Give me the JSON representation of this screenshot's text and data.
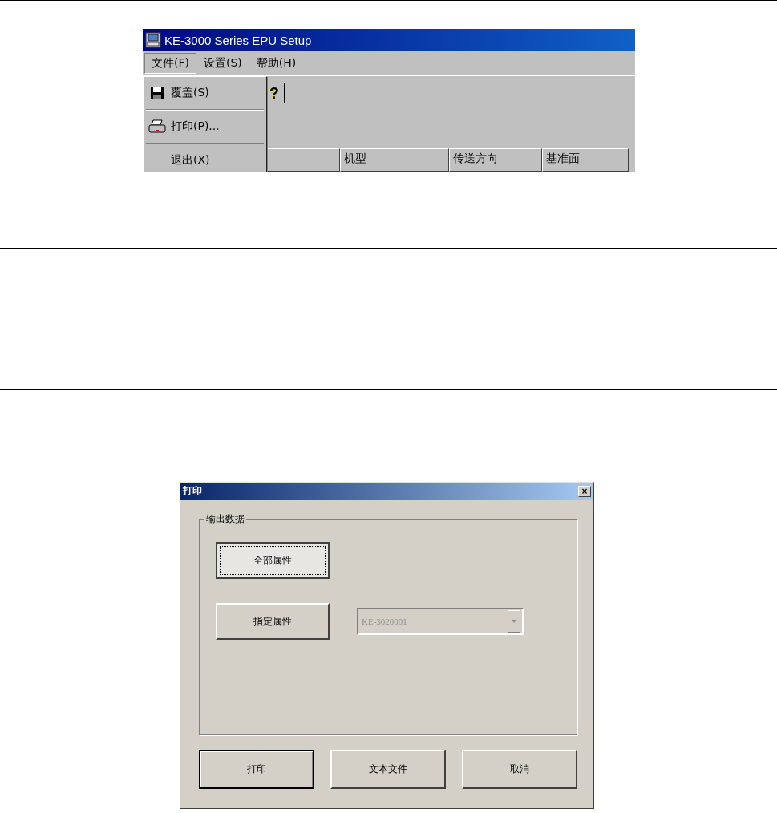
{
  "app_window": {
    "title": "KE-3000 Series EPU Setup",
    "menus": [
      {
        "label": "文件(F)",
        "selected": true
      },
      {
        "label": "设置(S)",
        "selected": false
      },
      {
        "label": "帮助(H)",
        "selected": false
      }
    ],
    "file_menu": {
      "items": [
        {
          "kind": "save",
          "label": "覆盖(S)"
        },
        {
          "kind": "print",
          "label": "打印(P)..."
        },
        {
          "kind": "plain",
          "label": "退出(X)"
        }
      ]
    },
    "toolbar": {
      "help_button": "?"
    },
    "table": {
      "columns": [
        "机型",
        "传送方向",
        "基准面"
      ]
    }
  },
  "print_dialog": {
    "title": "打印",
    "close": "×",
    "group": {
      "label": "输出数据",
      "buttons": [
        {
          "label": "全部属性",
          "focused": true
        },
        {
          "label": "指定属性",
          "focused": false
        }
      ],
      "dropdown": {
        "value": "KE-3020001",
        "disabled": true
      }
    },
    "buttons": [
      {
        "label": "打印",
        "default": true
      },
      {
        "label": "文本文件",
        "default": false
      },
      {
        "label": "取消",
        "default": false
      }
    ]
  }
}
